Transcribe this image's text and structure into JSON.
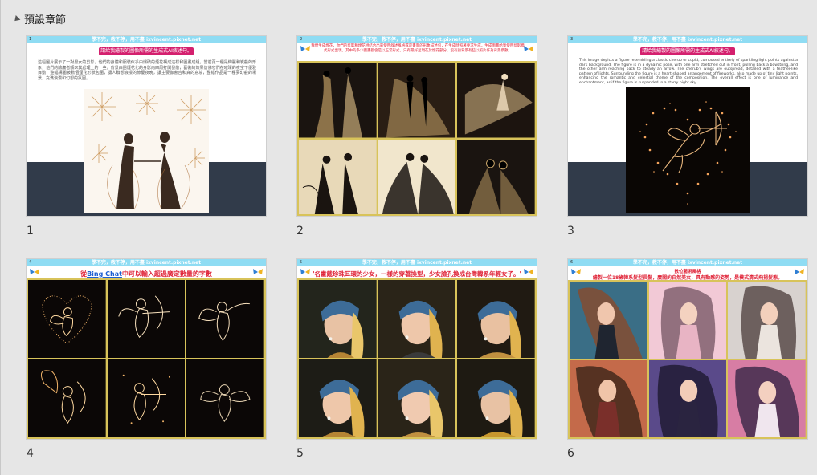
{
  "section": {
    "title": "預設章節"
  },
  "banner_text": "學不完，教不停，用不盡 ixvincent.pixnet.net",
  "slides": [
    {
      "number": "1",
      "index_label": "1",
      "pill": "請給我繪製的圖像所需的生成式AI敘述句。",
      "body": "這幅圖片展示了一對男女的剪影，他們的身體和服裝似乎由爆破的煙花構成這樣和圖畫成組，當前頁一種是絢麗和炭般的形象，他們的臉龐者額來其處理上的一些，背景由團煙花化的身影向四周打開發散，藝術的效果仿佛它們在璀璨的夜空下優雅舞動，整幅構圖被數個煙花形狀包圍，讓人聯想浪漫的節慶夜晚，讓主要像會合和真的意境，整幅作品是一種夢幻般的場景，充滿浪漫和幻想的氛圍。"
    },
    {
      "number": "2",
      "index_label": "2",
      "red_text": "我們生成煙花，你們的剪影和煙花相結合出來使用敘述風格或是畫面的形象描述句，在生成時照著要求生成，生成圖畫給我使用剪影模式形式出現，其中的多少圖畫都會是以正常形式，只有最好呈現在於煙花部分，沒有請背景有些以照片作為背景參數。"
    },
    {
      "number": "3",
      "index_label": "3",
      "pill": "請給我繪製的圖像所需的生成式AI敘述句。",
      "body": "This image depicts a figure resembling a classic cherub or cupid, composed entirely of sparkling light points against a dark background. The figure is in a dynamic pose, with one arm stretched out in front, pulling back a bowstring, and the other arm reaching back to steady an arrow. The cherub's wings are outspread, detailed with a feather-like pattern of lights. Surrounding the figure is a heart-shaped arrangement of fireworks, also made up of tiny light points, enhancing the romantic and celestial theme of the composition. The overall effect is one of luminance and enchantment, as if the figure is suspended in a starry night sky."
    },
    {
      "number": "4",
      "index_label": "4",
      "red_prefix": "從",
      "red_link": "Bing Chat",
      "red_suffix": "中可以輸入超過廣定數量的字數"
    },
    {
      "number": "5",
      "index_label": "5",
      "red_text": "'名畫戴珍珠耳環的少女，一樣的穿著換型，少女臉孔換成台灣韓系年輕女子。'"
    },
    {
      "number": "6",
      "index_label": "6",
      "red_title": "數位藝術風格",
      "red_text": "繪製一位18歲韓系髮型長髮，廣闊的自然美女，具有動感的姿勢，是模式清式飛揚髮態。"
    }
  ],
  "colors": {
    "banner": "#8fdcf3",
    "pill": "#d4206e",
    "dark_band": "#313b4a",
    "gold": "#d8c35a",
    "red_text": "#e0263a"
  }
}
